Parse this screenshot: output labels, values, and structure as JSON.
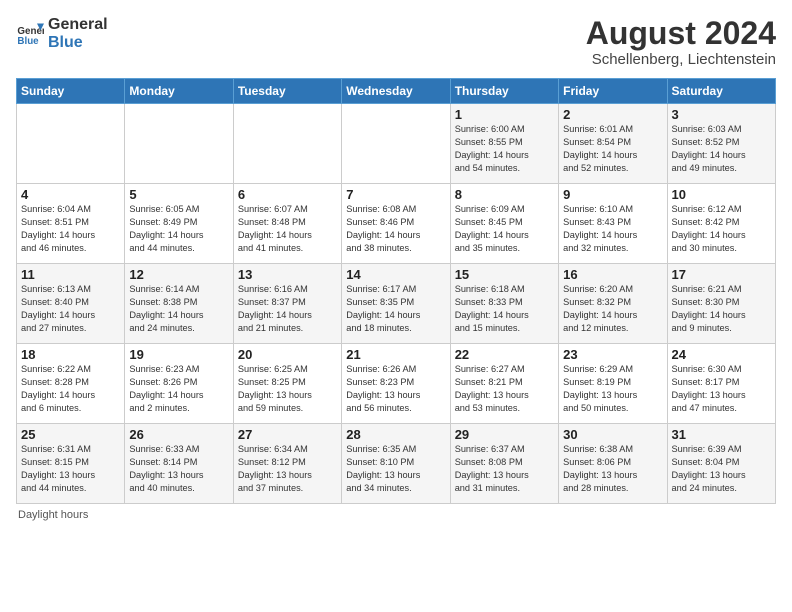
{
  "header": {
    "logo_general": "General",
    "logo_blue": "Blue",
    "month_year": "August 2024",
    "location": "Schellenberg, Liechtenstein"
  },
  "weekdays": [
    "Sunday",
    "Monday",
    "Tuesday",
    "Wednesday",
    "Thursday",
    "Friday",
    "Saturday"
  ],
  "weeks": [
    [
      {
        "day": "",
        "info": ""
      },
      {
        "day": "",
        "info": ""
      },
      {
        "day": "",
        "info": ""
      },
      {
        "day": "",
        "info": ""
      },
      {
        "day": "1",
        "info": "Sunrise: 6:00 AM\nSunset: 8:55 PM\nDaylight: 14 hours\nand 54 minutes."
      },
      {
        "day": "2",
        "info": "Sunrise: 6:01 AM\nSunset: 8:54 PM\nDaylight: 14 hours\nand 52 minutes."
      },
      {
        "day": "3",
        "info": "Sunrise: 6:03 AM\nSunset: 8:52 PM\nDaylight: 14 hours\nand 49 minutes."
      }
    ],
    [
      {
        "day": "4",
        "info": "Sunrise: 6:04 AM\nSunset: 8:51 PM\nDaylight: 14 hours\nand 46 minutes."
      },
      {
        "day": "5",
        "info": "Sunrise: 6:05 AM\nSunset: 8:49 PM\nDaylight: 14 hours\nand 44 minutes."
      },
      {
        "day": "6",
        "info": "Sunrise: 6:07 AM\nSunset: 8:48 PM\nDaylight: 14 hours\nand 41 minutes."
      },
      {
        "day": "7",
        "info": "Sunrise: 6:08 AM\nSunset: 8:46 PM\nDaylight: 14 hours\nand 38 minutes."
      },
      {
        "day": "8",
        "info": "Sunrise: 6:09 AM\nSunset: 8:45 PM\nDaylight: 14 hours\nand 35 minutes."
      },
      {
        "day": "9",
        "info": "Sunrise: 6:10 AM\nSunset: 8:43 PM\nDaylight: 14 hours\nand 32 minutes."
      },
      {
        "day": "10",
        "info": "Sunrise: 6:12 AM\nSunset: 8:42 PM\nDaylight: 14 hours\nand 30 minutes."
      }
    ],
    [
      {
        "day": "11",
        "info": "Sunrise: 6:13 AM\nSunset: 8:40 PM\nDaylight: 14 hours\nand 27 minutes."
      },
      {
        "day": "12",
        "info": "Sunrise: 6:14 AM\nSunset: 8:38 PM\nDaylight: 14 hours\nand 24 minutes."
      },
      {
        "day": "13",
        "info": "Sunrise: 6:16 AM\nSunset: 8:37 PM\nDaylight: 14 hours\nand 21 minutes."
      },
      {
        "day": "14",
        "info": "Sunrise: 6:17 AM\nSunset: 8:35 PM\nDaylight: 14 hours\nand 18 minutes."
      },
      {
        "day": "15",
        "info": "Sunrise: 6:18 AM\nSunset: 8:33 PM\nDaylight: 14 hours\nand 15 minutes."
      },
      {
        "day": "16",
        "info": "Sunrise: 6:20 AM\nSunset: 8:32 PM\nDaylight: 14 hours\nand 12 minutes."
      },
      {
        "day": "17",
        "info": "Sunrise: 6:21 AM\nSunset: 8:30 PM\nDaylight: 14 hours\nand 9 minutes."
      }
    ],
    [
      {
        "day": "18",
        "info": "Sunrise: 6:22 AM\nSunset: 8:28 PM\nDaylight: 14 hours\nand 6 minutes."
      },
      {
        "day": "19",
        "info": "Sunrise: 6:23 AM\nSunset: 8:26 PM\nDaylight: 14 hours\nand 2 minutes."
      },
      {
        "day": "20",
        "info": "Sunrise: 6:25 AM\nSunset: 8:25 PM\nDaylight: 13 hours\nand 59 minutes."
      },
      {
        "day": "21",
        "info": "Sunrise: 6:26 AM\nSunset: 8:23 PM\nDaylight: 13 hours\nand 56 minutes."
      },
      {
        "day": "22",
        "info": "Sunrise: 6:27 AM\nSunset: 8:21 PM\nDaylight: 13 hours\nand 53 minutes."
      },
      {
        "day": "23",
        "info": "Sunrise: 6:29 AM\nSunset: 8:19 PM\nDaylight: 13 hours\nand 50 minutes."
      },
      {
        "day": "24",
        "info": "Sunrise: 6:30 AM\nSunset: 8:17 PM\nDaylight: 13 hours\nand 47 minutes."
      }
    ],
    [
      {
        "day": "25",
        "info": "Sunrise: 6:31 AM\nSunset: 8:15 PM\nDaylight: 13 hours\nand 44 minutes."
      },
      {
        "day": "26",
        "info": "Sunrise: 6:33 AM\nSunset: 8:14 PM\nDaylight: 13 hours\nand 40 minutes."
      },
      {
        "day": "27",
        "info": "Sunrise: 6:34 AM\nSunset: 8:12 PM\nDaylight: 13 hours\nand 37 minutes."
      },
      {
        "day": "28",
        "info": "Sunrise: 6:35 AM\nSunset: 8:10 PM\nDaylight: 13 hours\nand 34 minutes."
      },
      {
        "day": "29",
        "info": "Sunrise: 6:37 AM\nSunset: 8:08 PM\nDaylight: 13 hours\nand 31 minutes."
      },
      {
        "day": "30",
        "info": "Sunrise: 6:38 AM\nSunset: 8:06 PM\nDaylight: 13 hours\nand 28 minutes."
      },
      {
        "day": "31",
        "info": "Sunrise: 6:39 AM\nSunset: 8:04 PM\nDaylight: 13 hours\nand 24 minutes."
      }
    ]
  ],
  "footer": {
    "note": "Daylight hours"
  }
}
